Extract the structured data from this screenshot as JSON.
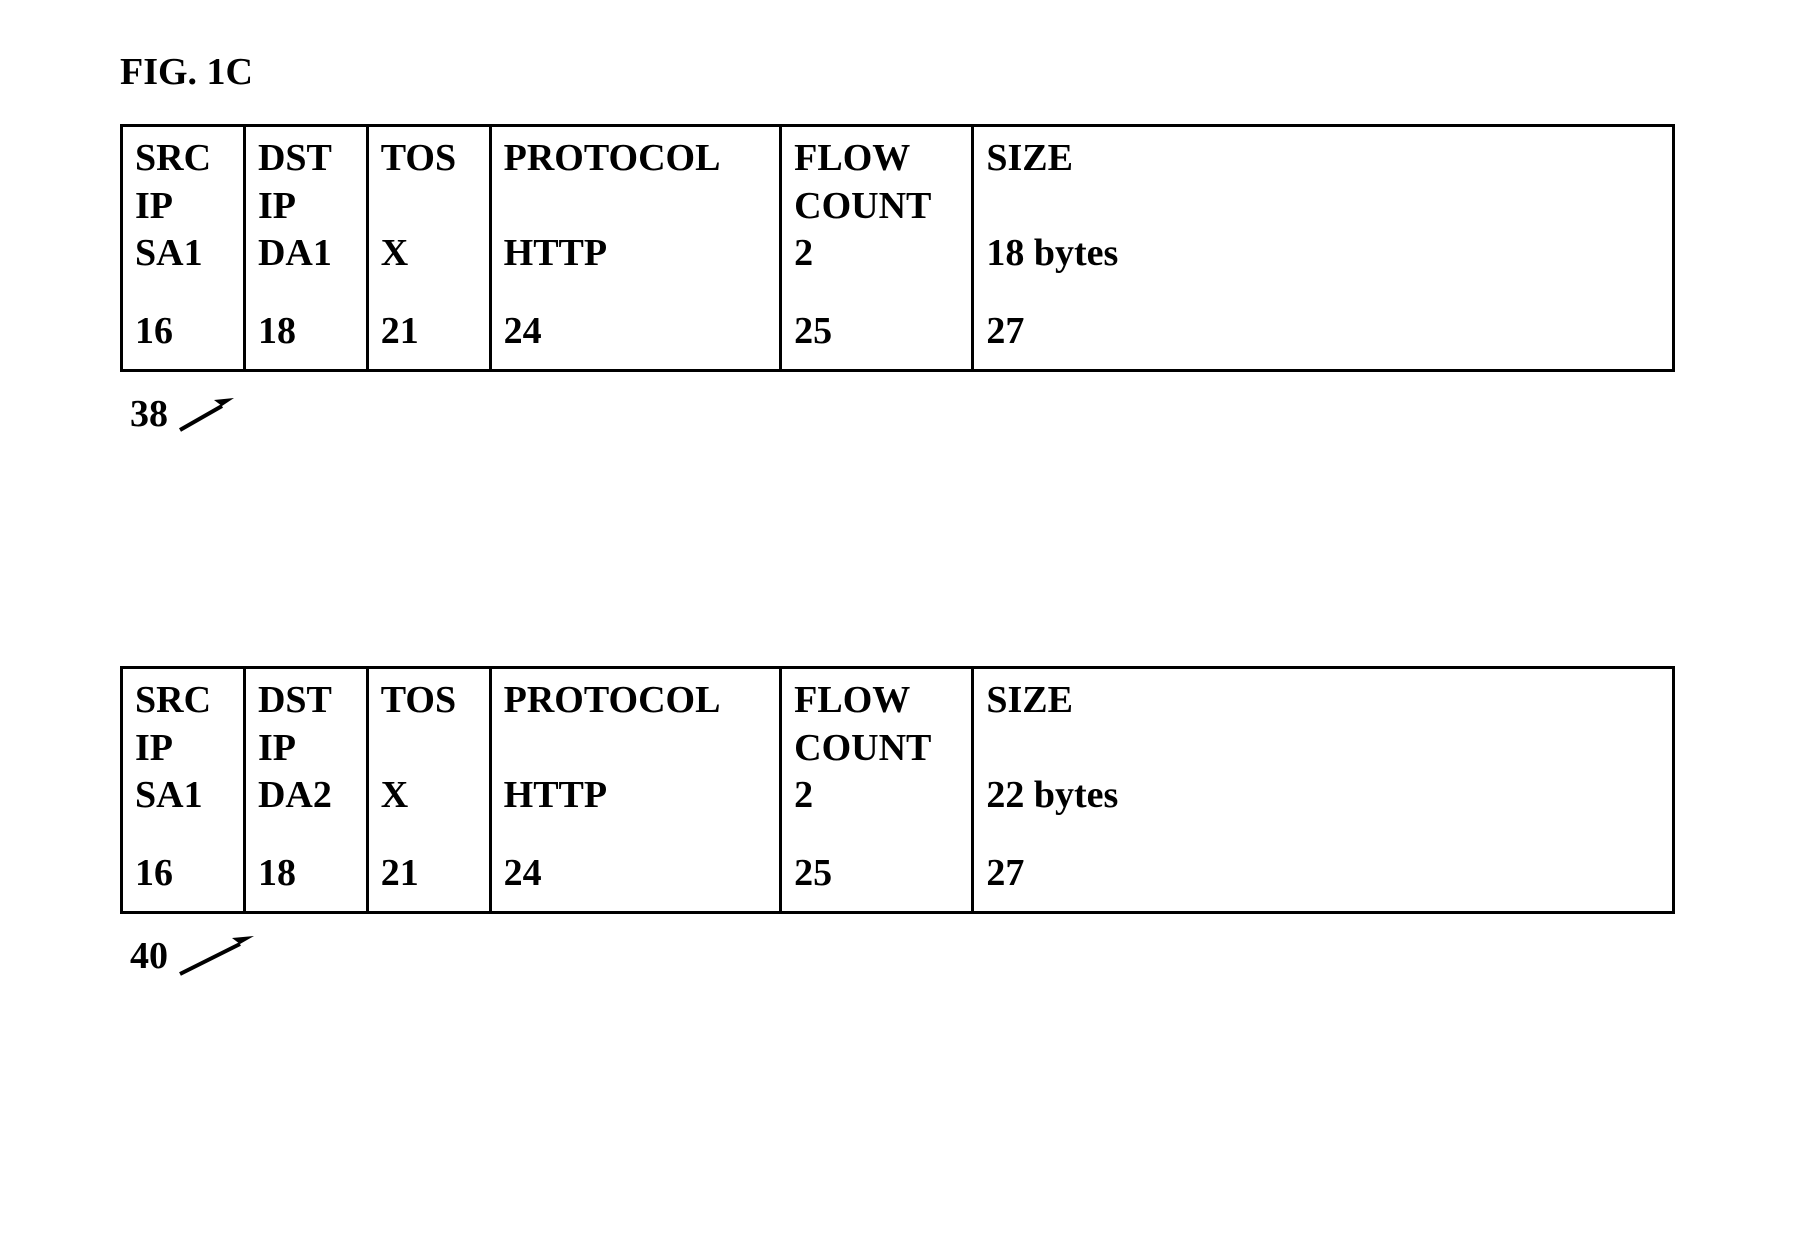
{
  "figure_label": "FIG. 1C",
  "table1": {
    "ref_number": "38",
    "headers": [
      "SRC IP",
      "DST IP",
      "TOS",
      "PROTOCOL",
      "FLOW COUNT",
      "SIZE"
    ],
    "values": [
      "SA1",
      "DA1",
      "X",
      "HTTP",
      "2",
      "18 bytes"
    ],
    "footers": [
      "16",
      "18",
      "21",
      "24",
      "25",
      "27"
    ]
  },
  "table2": {
    "ref_number": "40",
    "headers": [
      "SRC IP",
      "DST IP",
      "TOS",
      "PROTOCOL",
      "FLOW COUNT",
      "SIZE"
    ],
    "values": [
      "SA1",
      "DA2",
      "X",
      "HTTP",
      "2",
      "22 bytes"
    ],
    "footers": [
      "16",
      "18",
      "21",
      "24",
      "25",
      "27"
    ]
  }
}
